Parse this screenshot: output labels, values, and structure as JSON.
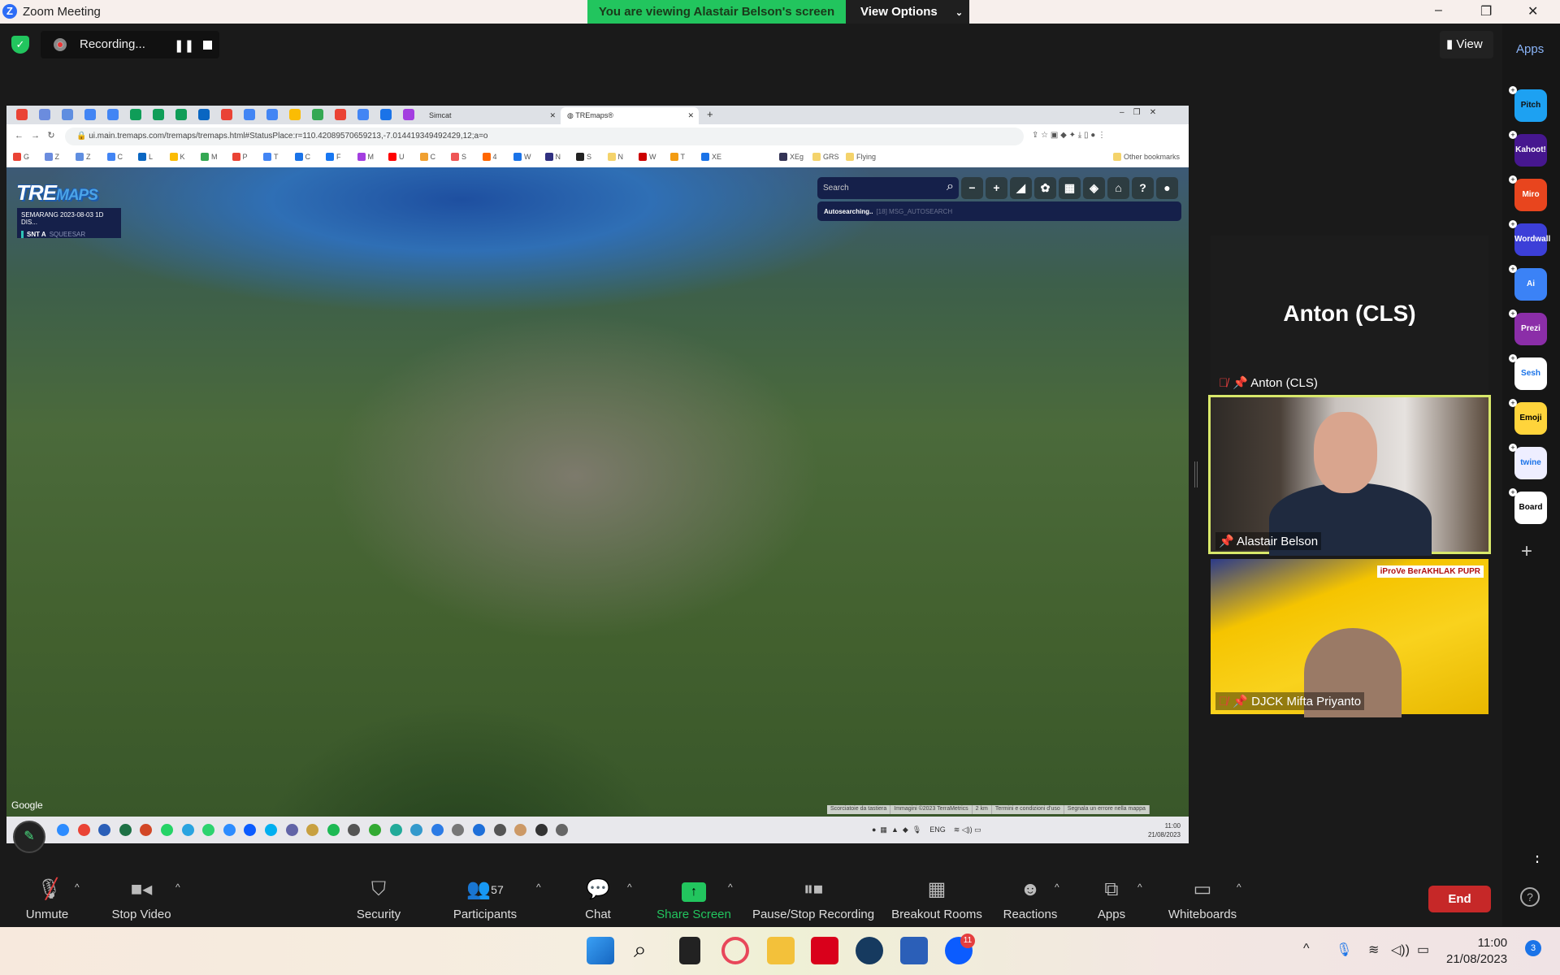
{
  "window": {
    "title": "Zoom Meeting",
    "banner": "You are viewing Alastair Belson's screen",
    "view_options": "View Options"
  },
  "top": {
    "recording": "Recording...",
    "view": "View",
    "apps": "Apps"
  },
  "browser": {
    "tabs": [
      {
        "label": "Simcat"
      },
      {
        "label": "TREmaps®"
      }
    ],
    "url": "ui.main.tremaps.com/tremaps/tremaps.html#StatusPlace:r=110.42089570659213,-7.014419349492429,12;a=o",
    "bookmarks": [
      "G",
      "Z",
      "Z",
      "C",
      "L",
      "K",
      "M",
      "P",
      "T",
      "C",
      "F",
      "M",
      "U",
      "C",
      "S",
      "4",
      "W",
      "N",
      "S",
      "N",
      "W",
      "T",
      "XE",
      "XEg",
      "GRS",
      "Flying"
    ],
    "other_bookmarks": "Other bookmarks"
  },
  "map": {
    "logo": "TREmaps",
    "layer_title": "SEMARANG 2023-08-03 1D DIS...",
    "layer_sub": "SNT A",
    "layer_sub2": "SQUEESAR",
    "search_placeholder": "Search",
    "autosearch": "Autosearching..",
    "autosearch_msg": "[18] MSG_AUTOSEARCH",
    "google": "Google",
    "attribution": [
      "Scorciatoie da tastiera",
      "Immagini ©2023 TerraMetrics",
      "2 km",
      "Termini e condizioni d'uso",
      "Segnala un errore nella mappa"
    ]
  },
  "shared_taskbar": {
    "lang": "ENG",
    "time": "11:00",
    "date": "21/08/2023"
  },
  "participants_video": [
    {
      "name": "Anton (CLS)",
      "muted": true
    },
    {
      "name": "Alastair Belson",
      "muted": false,
      "active_speaker": true
    },
    {
      "name": "DJCK Mifta Priyanto",
      "muted": true,
      "background_text": "iProVe BerAKHLAK PUPR"
    }
  ],
  "apps_sidebar": [
    "Pitch",
    "Kahoot!",
    "Miro",
    "Wordwall",
    "Ai",
    "Prezi",
    "Sesh",
    "Emoji",
    "twine",
    "Board"
  ],
  "toolbar": {
    "unmute": "Unmute",
    "stop_video": "Stop Video",
    "security": "Security",
    "participants": "Participants",
    "participants_count": "57",
    "chat": "Chat",
    "share_screen": "Share Screen",
    "recording": "Pause/Stop Recording",
    "breakout": "Breakout Rooms",
    "reactions": "Reactions",
    "apps": "Apps",
    "whiteboards": "Whiteboards",
    "end": "End"
  },
  "taskbar": {
    "time": "11:00",
    "date": "21/08/2023",
    "zoom_badge": "11",
    "notifications": "3"
  },
  "colors": {
    "banner": "#22c55e",
    "end": "#c62828",
    "share": "#22c55e",
    "speaker_border": "#d8e86a"
  }
}
